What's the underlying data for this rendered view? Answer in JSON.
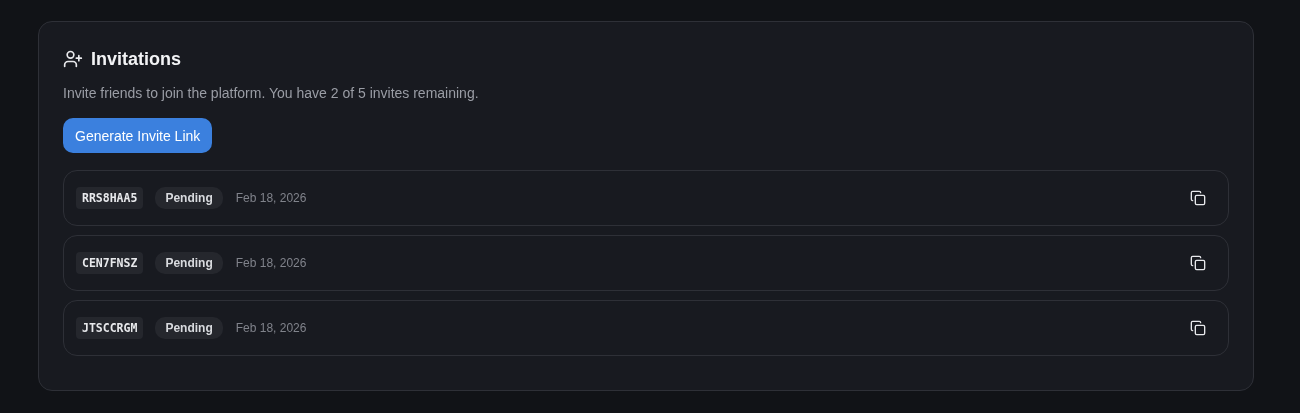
{
  "card": {
    "title": "Invitations",
    "description": "Invite friends to join the platform. You have 2 of 5 invites remaining.",
    "button": "Generate Invite Link"
  },
  "invites": [
    {
      "code": "RRS8HAA5",
      "status": "Pending",
      "date": "Feb 18, 2026"
    },
    {
      "code": "CEN7FNSZ",
      "status": "Pending",
      "date": "Feb 18, 2026"
    },
    {
      "code": "JTSCCRGM",
      "status": "Pending",
      "date": "Feb 18, 2026"
    }
  ]
}
